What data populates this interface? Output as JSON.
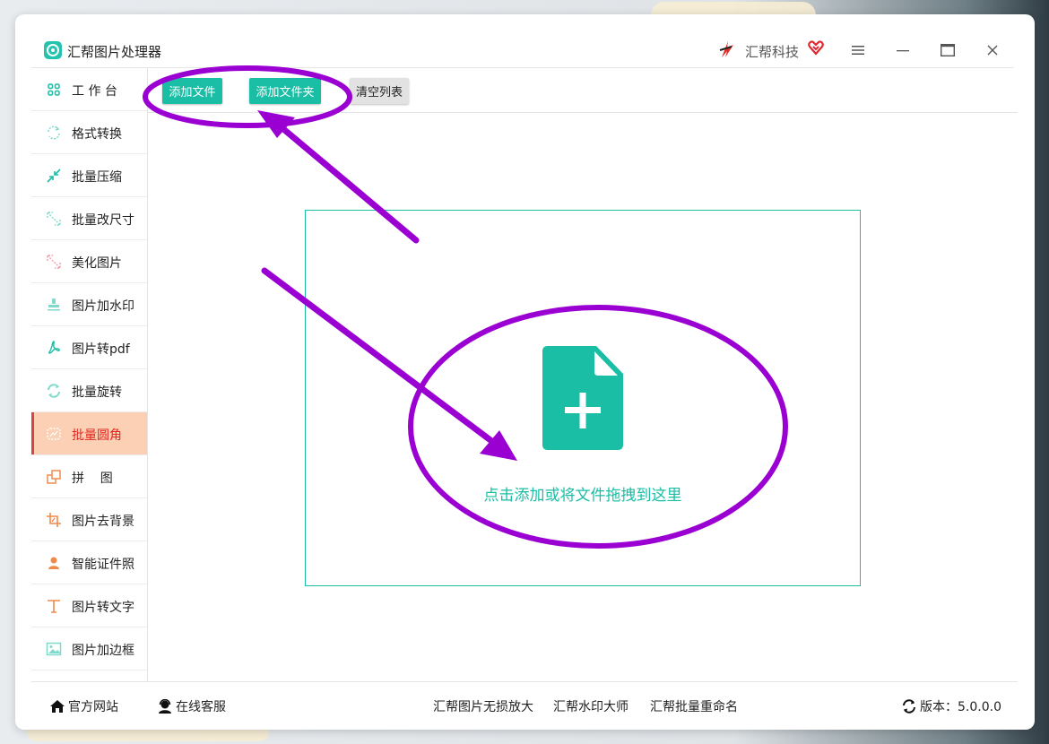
{
  "window": {
    "title": "汇帮图片处理器",
    "brand": "汇帮科技"
  },
  "colors": {
    "accent": "#19bea5",
    "active_bg": "#fbd0b5",
    "active_text": "#e0261e",
    "annotation": "#9b00d3"
  },
  "sidebar": {
    "items": [
      {
        "label": "工 作 台",
        "icon": "grid-icon",
        "active": false
      },
      {
        "label": "格式转换",
        "icon": "convert-icon",
        "active": false
      },
      {
        "label": "批量压缩",
        "icon": "compress-icon",
        "active": false
      },
      {
        "label": "批量改尺寸",
        "icon": "resize-icon",
        "active": false
      },
      {
        "label": "美化图片",
        "icon": "beautify-icon",
        "active": false
      },
      {
        "label": "图片加水印",
        "icon": "stamp-icon",
        "active": false
      },
      {
        "label": "图片转pdf",
        "icon": "pdf-icon",
        "active": false
      },
      {
        "label": "批量旋转",
        "icon": "rotate-icon",
        "active": false
      },
      {
        "label": "批量圆角",
        "icon": "rounded-corner-icon",
        "active": true
      },
      {
        "label": "拼    图",
        "icon": "collage-icon",
        "active": false
      },
      {
        "label": "图片去背景",
        "icon": "crop-icon",
        "active": false
      },
      {
        "label": "智能证件照",
        "icon": "person-icon",
        "active": false
      },
      {
        "label": "图片转文字",
        "icon": "text-icon",
        "active": false
      },
      {
        "label": "图片加边框",
        "icon": "frame-icon",
        "active": false
      }
    ]
  },
  "toolbar": {
    "add_file": "添加文件",
    "add_folder": "添加文件夹",
    "clear_list": "清空列表"
  },
  "dropzone": {
    "hint": "点击添加或将文件拖拽到这里",
    "icon": "add-file-icon"
  },
  "footer": {
    "website": "官方网站",
    "support": "在线客服",
    "link1": "汇帮图片无损放大",
    "link2": "汇帮水印大师",
    "link3": "汇帮批量重命名",
    "version": "版本：5.0.0.0"
  }
}
